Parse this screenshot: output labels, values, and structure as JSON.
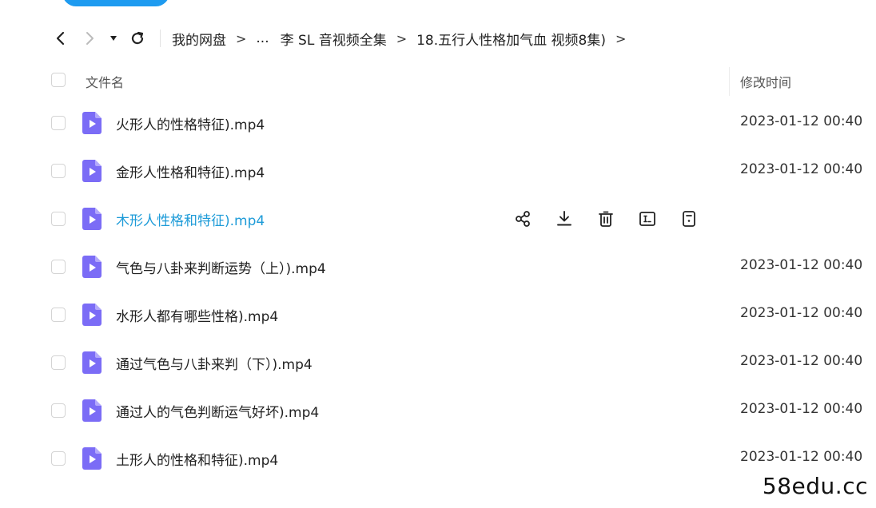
{
  "breadcrumb": {
    "root": "我的网盘",
    "ellipsis": "...",
    "folder1": "李 SL 音视频全集",
    "folder2": "18.五行人性格加气血 视频8集)",
    "sep": ">"
  },
  "header": {
    "name": "文件名",
    "time": "修改时间"
  },
  "files": [
    {
      "name": "火形人的性格特征).mp4",
      "time": "2023-01-12 00:40"
    },
    {
      "name": "金形人性格和特征).mp4",
      "time": "2023-01-12 00:40"
    },
    {
      "name": "木形人性格和特征).mp4",
      "time": ""
    },
    {
      "name": "气色与八卦来判断运势（上）).mp4",
      "time": "2023-01-12 00:40"
    },
    {
      "name": "水形人都有哪些性格).mp4",
      "time": "2023-01-12 00:40"
    },
    {
      "name": "通过气色与八卦来判（下）).mp4",
      "time": "2023-01-12 00:40"
    },
    {
      "name": "通过人的气色判断运气好坏).mp4",
      "time": "2023-01-12 00:40"
    },
    {
      "name": "土形人的性格和特征).mp4",
      "time": "2023-01-12 00:40"
    }
  ],
  "hover_row_actions": [
    "share-icon",
    "download-icon",
    "delete-icon",
    "rename-icon",
    "more-icon"
  ],
  "colors": {
    "accent": "#1d9bd8",
    "file_icon": "#7b6cf6"
  },
  "watermark": "58edu.cc"
}
